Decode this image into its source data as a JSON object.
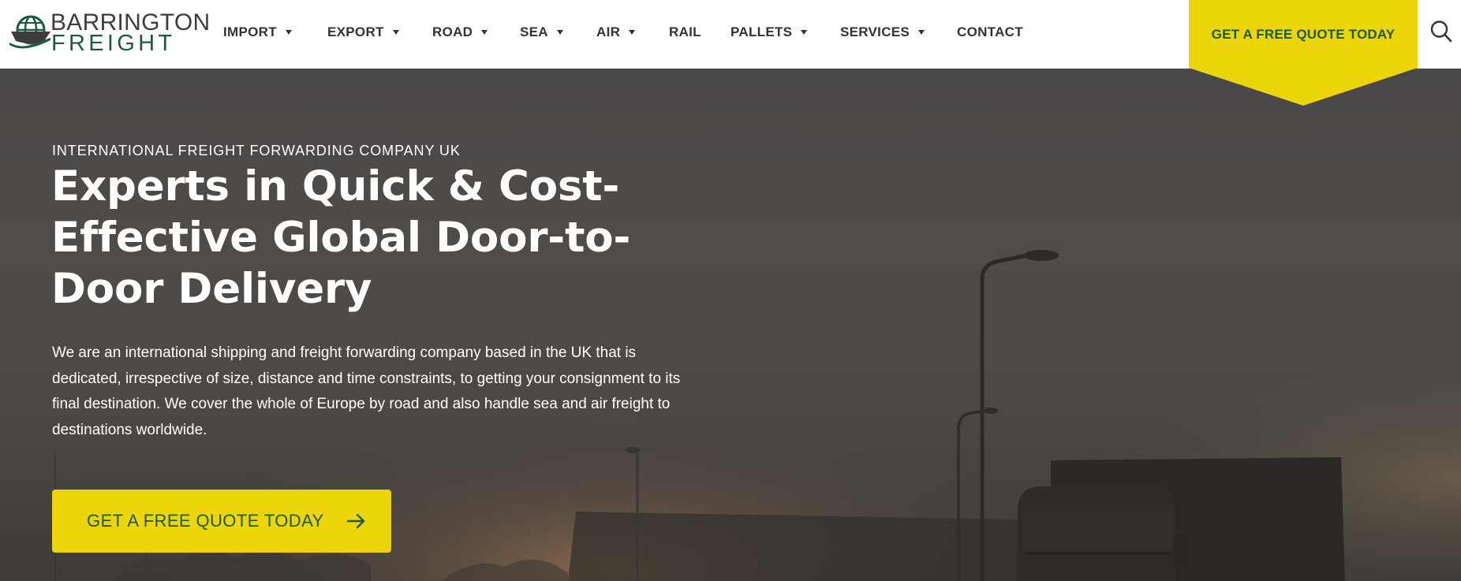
{
  "brand": {
    "line1": "BARRINGTON",
    "line2": "FREIGHT",
    "colors": {
      "green": "#1d5a3f",
      "yellow": "#ecd50a",
      "gray": "#3d3d3d"
    }
  },
  "nav": {
    "items": [
      {
        "label": "IMPORT",
        "has_dropdown": true
      },
      {
        "label": "EXPORT",
        "has_dropdown": true
      },
      {
        "label": "ROAD",
        "has_dropdown": true
      },
      {
        "label": "SEA",
        "has_dropdown": true
      },
      {
        "label": "AIR",
        "has_dropdown": true
      },
      {
        "label": "RAIL",
        "has_dropdown": false
      },
      {
        "label": "PALLETS",
        "has_dropdown": true
      },
      {
        "label": "SERVICES",
        "has_dropdown": true
      },
      {
        "label": "CONTACT",
        "has_dropdown": false
      }
    ],
    "cta_label": "GET A FREE QUOTE TODAY",
    "search_icon": "search-icon"
  },
  "hero": {
    "eyebrow": "INTERNATIONAL FREIGHT FORWARDING COMPANY UK",
    "headline_lines": [
      "Experts in Quick & Cost-",
      "Effective Global Door-to-",
      "Door Delivery"
    ],
    "intro_lines": [
      "We are an international shipping and freight forwarding company based in the UK that is",
      "dedicated, irrespective of size, distance and time constraints, to getting your consignment to its",
      "final destination. We cover the whole of Europe by road and also handle sea and air freight to",
      "destinations worldwide."
    ],
    "cta_label": "GET A FREE QUOTE TODAY",
    "cta_icon": "arrow-right-icon"
  }
}
